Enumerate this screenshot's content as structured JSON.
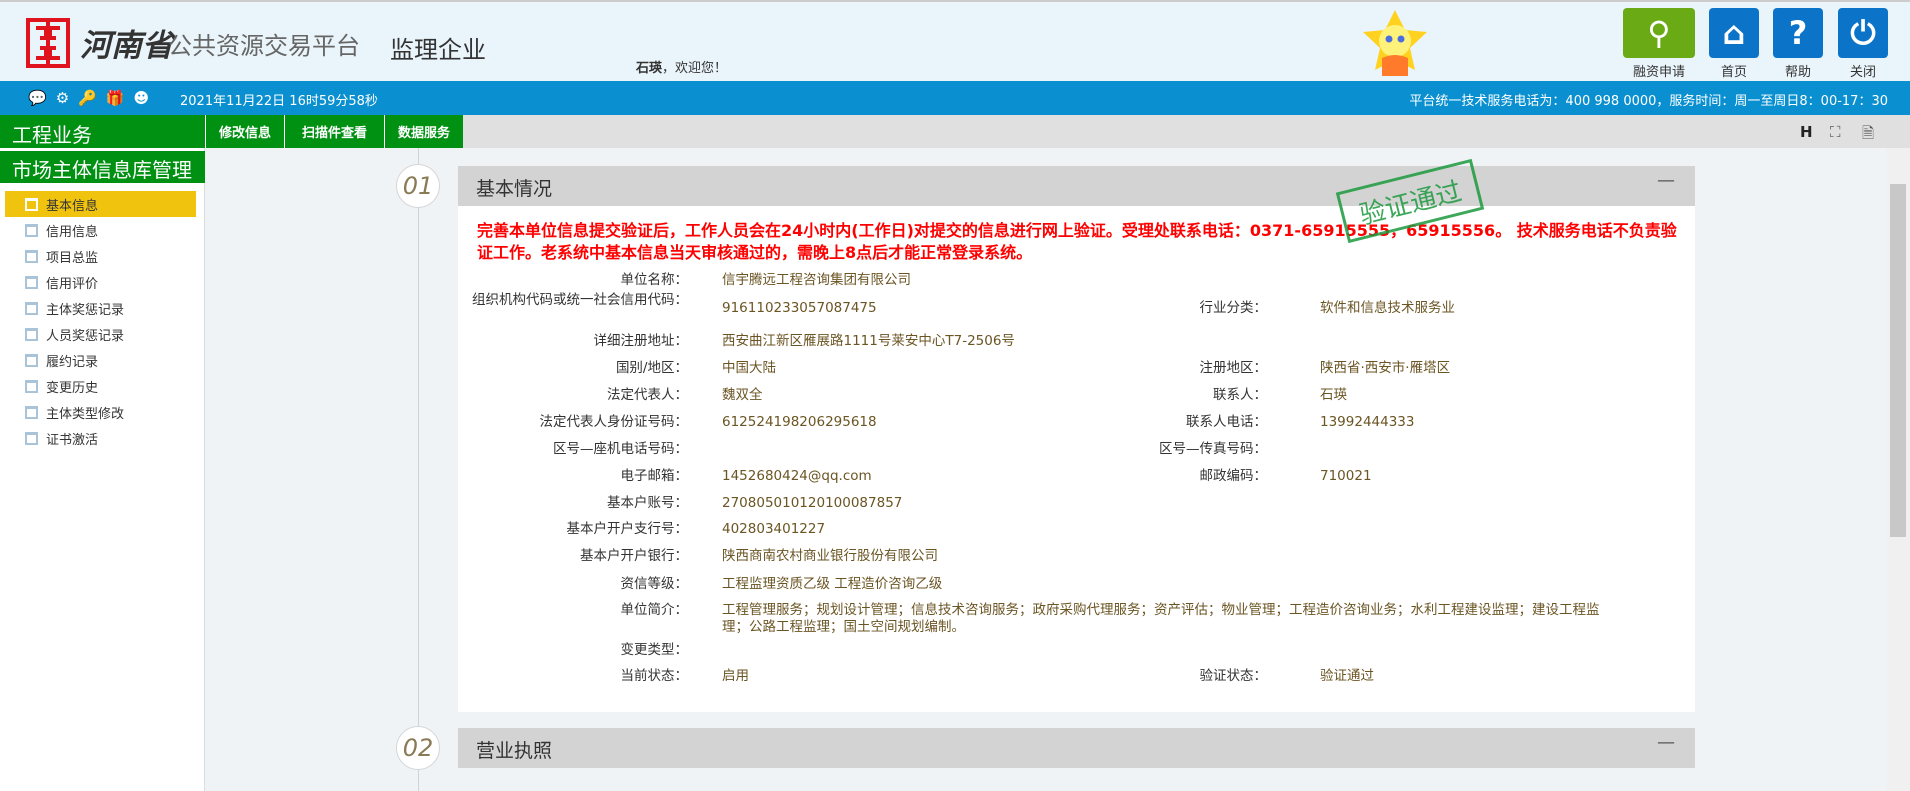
{
  "header": {
    "brand_main": "河南省",
    "brand_sub": "公共资源交易平台",
    "role": "监理企业",
    "welcome_user": "石瑛",
    "welcome_text": "，欢迎您！",
    "buttons": [
      {
        "label": "融资申请",
        "icon": "financing-icon",
        "color": "#6aaa14"
      },
      {
        "label": "首页",
        "icon": "home-icon",
        "color": "#0b74c8"
      },
      {
        "label": "帮助",
        "icon": "help-icon",
        "color": "#0b74c8"
      },
      {
        "label": "关闭",
        "icon": "power-icon",
        "color": "#0b74c8"
      }
    ]
  },
  "infobar": {
    "datetime": "2021年11月22日 16时59分58秒",
    "hotline": "平台统一技术服务电话为：400 998 0000，服务时间：周一至周日8：00-17：30",
    "icons": [
      "message-icon",
      "gear-icon",
      "key-icon",
      "gift-icon",
      "people-icon"
    ]
  },
  "nav": {
    "section": "工程业务",
    "tabs": [
      "修改信息",
      "扫描件查看",
      "数据服务"
    ],
    "right_icons": [
      "history-icon",
      "sitemap-icon",
      "pdf-icon"
    ]
  },
  "sidebar": {
    "title": "市场主体信息库管理",
    "items": [
      "基本信息",
      "信用信息",
      "项目总监",
      "信用评价",
      "主体奖惩记录",
      "人员奖惩记录",
      "履约记录",
      "变更历史",
      "主体类型修改",
      "证书激活"
    ],
    "active": 0
  },
  "section1": {
    "number": "01",
    "title": "基本情况",
    "collapse": "—",
    "stamp": "验证通过",
    "notice": "完善本单位信息提交验证后，工作人员会在24小时内(工作日)对提交的信息进行网上验证。受理处联系电话：0371-65915555，65915556。 技术服务电话不负责验证工作。老系统中基本信息当天审核通过的，需晚上8点后才能正常登录系统。",
    "rows": [
      {
        "label": "单位名称：",
        "value": "信宇腾远工程咨询集团有限公司"
      },
      {
        "label": "组织机构代码或统一社会信用代码：",
        "value": "916110233057087475",
        "label2": "行业分类：",
        "value2": "软件和信息技术服务业"
      },
      {
        "label": "详细注册地址：",
        "value": "西安曲江新区雁展路1111号莱安中心T7-2506号"
      },
      {
        "label": "国别/地区：",
        "value": "中国大陆",
        "label2": "注册地区：",
        "value2": "陕西省·西安市·雁塔区"
      },
      {
        "label": "法定代表人：",
        "value": "魏双全",
        "label2": "联系人：",
        "value2": "石瑛"
      },
      {
        "label": "法定代表人身份证号码：",
        "value": "612524198206295618",
        "label2": "联系人电话：",
        "value2": "13992444333"
      },
      {
        "label": "区号—座机电话号码：",
        "value": "",
        "label2": "区号—传真号码：",
        "value2": ""
      },
      {
        "label": "电子邮箱：",
        "value": "1452680424@qq.com",
        "label2": "邮政编码：",
        "value2": "710021"
      },
      {
        "label": "基本户账号：",
        "value": "270805010120100087857"
      },
      {
        "label": "基本户开户支行号：",
        "value": "402803401227"
      },
      {
        "label": "基本户开户银行：",
        "value": "陕西商南农村商业银行股份有限公司"
      },
      {
        "label": "资信等级：",
        "value": "工程监理资质乙级 工程造价咨询乙级"
      },
      {
        "label": "单位简介：",
        "value": "工程管理服务；规划设计管理；信息技术咨询服务；政府采购代理服务；资产评估；物业管理；工程造价咨询业务；水利工程建设监理；建设工程监理；公路工程监理；国土空间规划编制。"
      },
      {
        "label": "变更类型：",
        "value": ""
      },
      {
        "label": "当前状态：",
        "value": "启用",
        "label2": "验证状态：",
        "value2": "验证通过"
      }
    ]
  },
  "section2": {
    "number": "02",
    "title": "营业执照",
    "collapse": "—"
  }
}
